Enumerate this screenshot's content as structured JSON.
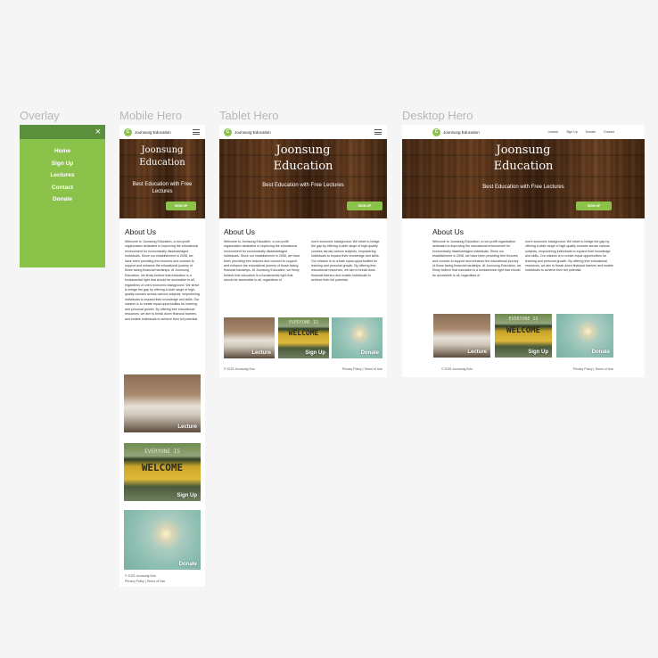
{
  "frames": {
    "overlay": "Overlay",
    "mobile": "Mobile Hero",
    "tablet": "Tablet Hero",
    "desktop": "Desktop Hero"
  },
  "overlay": {
    "close_icon": "×",
    "items": [
      "Home",
      "Sign Up",
      "Lectures",
      "Contact",
      "Donate"
    ]
  },
  "brand": {
    "logo_letter": "C",
    "name": "Joonsung Education"
  },
  "nav": [
    "Lecture",
    "Sign Up",
    "Donate",
    "Contact"
  ],
  "hero": {
    "title_line1": "Joonsung",
    "title_line2": "Education",
    "subtitle": "Best Education with Free Lectures",
    "cta": "SIGN UP"
  },
  "about": {
    "heading": "About Us",
    "mobile_text": "Welcome to Joonsung Education, a non-profit organization dedicated to improving the educational environment for economically disadvantaged individuals. Since our establishment in 2008, we have been providing free lectures and courses to support and enhance the educational journey of those facing financial hardships. At Joonsung Education, we firmly believe that education is a fundamental right that should be accessible to all, regardless of one's economic background. We strive to bridge the gap by offering a wide range of high-quality courses across various subjects, empowering individuals to expand their knowledge and skills. Our mission is to create equal opportunities for learning and personal growth. By offering free educational resources, we aim to break down financial barriers and enable individuals to achieve their full potential.",
    "tablet_col1": "Welcome to Joonsung Education, a non-profit organization dedicated to improving the educational environment for economically disadvantaged individuals. Since our establishment in 2008, we have been providing free lectures and courses to support and enhance the educational journey of those facing financial hardships. At Joonsung Education, we firmly believe that education is a fundamental right that should be accessible to all, regardless of",
    "tablet_col2": "one's economic background. We strive to bridge the gap by offering a wide range of high-quality courses across various subjects, empowering individuals to expand their knowledge and skills. Our mission is to create equal opportunities for learning and personal growth. By offering free educational resources, we aim to break down financial barriers and enable individuals to achieve their full potential.",
    "desktop_col1": "Welcome to Joonsung Education, a non-profit organization dedicated to improving the educational environment for economically disadvantaged individuals. Since our establishment in 2008, we have been providing free lectures and courses to support and enhance the educational journey of those facing financial hardships. At Joonsung Education, we firmly believe that education is a fundamental right that should be accessible to all, regardless of",
    "desktop_col2": "one's economic background. We strive to bridge the gap by offering a wide range of high-quality courses across various subjects, empowering individuals to expand their knowledge and skills. Our mission is to create equal opportunities for learning and personal growth. By offering free educational resources, we aim to break down financial barriers and enable individuals to achieve their full potential."
  },
  "tiles": {
    "lecture": "Lecture",
    "signup": "Sign Up",
    "donate": "Donate",
    "sign_top": "EVERYONE IS",
    "sign_word": "WELCOME"
  },
  "footer": {
    "copyright": "© 2023 Joonsung Edu",
    "links": "Privacy Policy | Terms of Use"
  }
}
